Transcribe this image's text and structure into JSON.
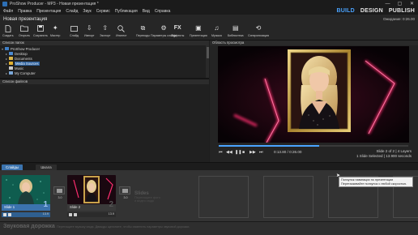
{
  "window": {
    "title": "ProShow Producer - МР3 - Новая презентация *",
    "controls": [
      "—",
      "▢",
      "✕"
    ]
  },
  "menu": [
    "Файл",
    "Правка",
    "Презентация",
    "Слайд",
    "Звук",
    "Сервис",
    "Публикация",
    "Вид",
    "Справка"
  ],
  "modes": {
    "build": "BUILD",
    "design": "DESIGN",
    "publish": "PUBLISH",
    "active": "build"
  },
  "document": {
    "title": "Новая презентация",
    "status": "Ожидание: 0:26.00"
  },
  "toolbar": [
    {
      "id": "create",
      "label": "Создать",
      "icon": "new-doc-icon"
    },
    {
      "id": "open",
      "label": "Открыть",
      "icon": "open-folder-icon"
    },
    {
      "id": "save",
      "label": "Сохранить",
      "icon": "save-icon"
    },
    {
      "id": "wizard",
      "label": "Мастер",
      "icon": "wizard-icon"
    },
    {
      "id": "slide",
      "label": "Слайд",
      "icon": "slide-icon"
    },
    {
      "id": "import",
      "label": "Импорт",
      "icon": "import-icon"
    },
    {
      "id": "export",
      "label": "Экспорт",
      "icon": "export-icon"
    },
    {
      "id": "inspect",
      "label": "Инспект",
      "icon": "inspect-icon"
    },
    {
      "id": "transitions",
      "label": "Переходы",
      "icon": "transitions-icon"
    },
    {
      "id": "slide-options",
      "label": "Параметры слайда",
      "icon": "slide-options-icon"
    },
    {
      "id": "effects",
      "label": "Эффекты",
      "icon": "fx-icon"
    },
    {
      "id": "show",
      "label": "Презентация",
      "icon": "show-icon"
    },
    {
      "id": "music",
      "label": "Музыка",
      "icon": "music-icon"
    },
    {
      "id": "library",
      "label": "Библиотека",
      "icon": "library-icon"
    },
    {
      "id": "sync",
      "label": "Синхронизация",
      "icon": "sync-icon"
    }
  ],
  "folders": {
    "header": "Список папок",
    "items": [
      {
        "label": "ProShow Producer",
        "level": 0,
        "expanded": true,
        "selected": false
      },
      {
        "label": "Desktop",
        "level": 1,
        "expanded": false,
        "selected": false
      },
      {
        "label": "Documents",
        "level": 1,
        "expanded": false,
        "selected": false
      },
      {
        "label": "Media Sources",
        "level": 1,
        "expanded": false,
        "selected": true
      },
      {
        "label": "Music",
        "level": 1,
        "expanded": false,
        "selected": false
      },
      {
        "label": "My Computer",
        "level": 1,
        "expanded": false,
        "selected": false
      }
    ]
  },
  "files": {
    "header": "Список файлов"
  },
  "preview": {
    "header": "Область просмотра",
    "time": "0:13.80 / 0:26.00",
    "progress": 0.53,
    "slide_info_1": "Slide 2 of 2  |  4 Layers",
    "slide_info_2": "1 Slide Selected  |  13.900 seconds",
    "buttons": [
      "⏮",
      "◀◀",
      "❚❚",
      "■",
      "▶▶",
      "⏭"
    ]
  },
  "lower_tabs": [
    {
      "label": "Слайды",
      "active": true
    },
    {
      "label": "Шкала",
      "active": false
    }
  ],
  "slides": [
    {
      "label": "Slide 1",
      "number": "1",
      "duration": "13.9",
      "selected": true
    },
    {
      "label": "Slide 2",
      "number": "2",
      "duration": "13.9",
      "selected": false
    }
  ],
  "transitions": [
    "3.0",
    "3.0"
  ],
  "placeholder": {
    "title": "Slides",
    "line1": "Перетащите фото",
    "line2": "и видео сюда"
  },
  "tooltip": {
    "line1": "Ползунок навигации по презентации",
    "line2": "Перетаскивайте ползунок с любой скоростью."
  },
  "soundtrack": {
    "label": "Звуковая дорожка",
    "hint": "Перетащите музыку сюда. Дважды щелкните, чтобы изменить параметры звуковой дорожки."
  },
  "colors": {
    "accent": "#3b73ae",
    "active_mode": "#4aa3ff",
    "neon": "#ff2d6f"
  }
}
